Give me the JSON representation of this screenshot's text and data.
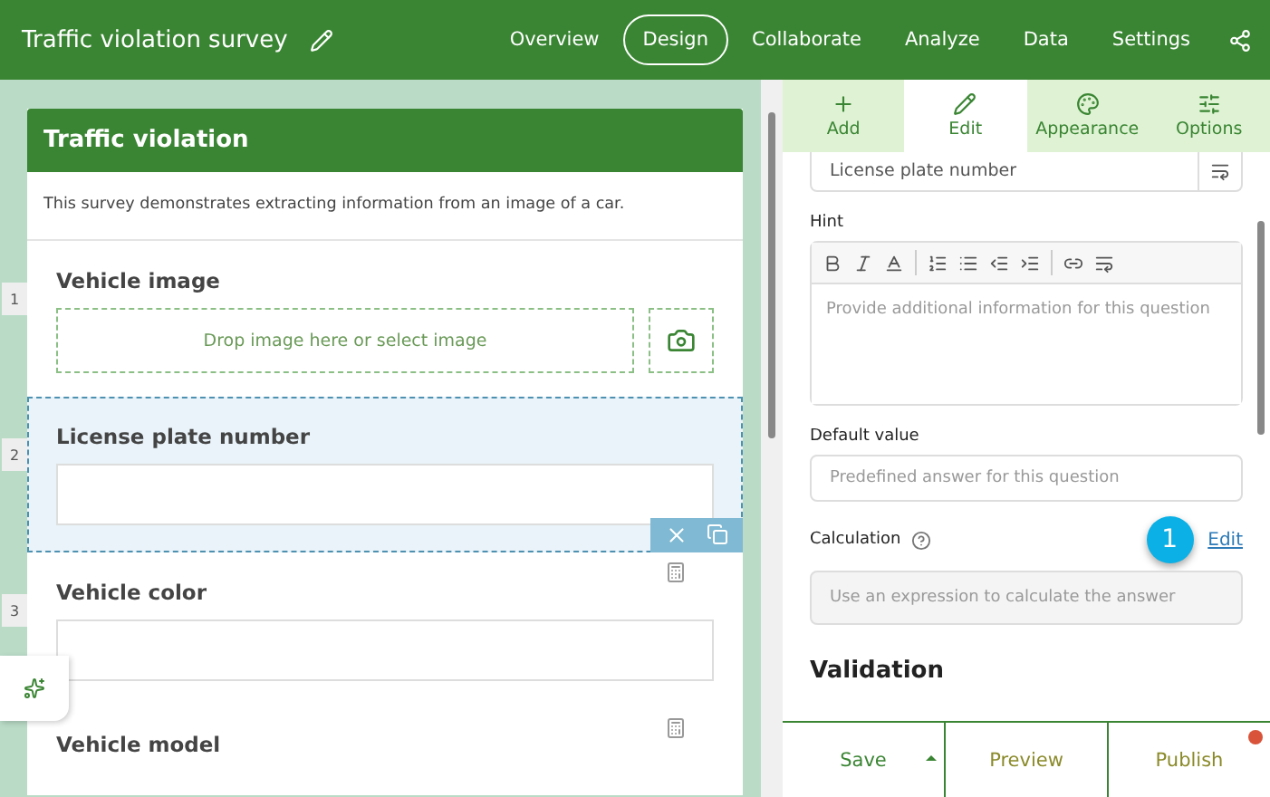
{
  "header": {
    "title": "Traffic violation survey",
    "nav": [
      {
        "label": "Overview",
        "selected": false
      },
      {
        "label": "Design",
        "selected": true
      },
      {
        "label": "Collaborate",
        "selected": false
      },
      {
        "label": "Analyze",
        "selected": false
      },
      {
        "label": "Data",
        "selected": false
      },
      {
        "label": "Settings",
        "selected": false
      }
    ]
  },
  "survey": {
    "title": "Traffic violation",
    "description": "This survey demonstrates extracting information from an image of a car.",
    "questions": [
      {
        "number": "1",
        "label": "Vehicle image",
        "kind": "image",
        "selected": false,
        "placeholder": "Drop image here or select image",
        "calculated": false
      },
      {
        "number": "2",
        "label": "License plate number",
        "kind": "text",
        "selected": true,
        "calculated": false
      },
      {
        "number": "3",
        "label": "Vehicle color",
        "kind": "text",
        "selected": false,
        "calculated": true
      },
      {
        "label": "Vehicle model",
        "kind": "label",
        "selected": false,
        "calculated": true
      }
    ]
  },
  "panel": {
    "tabs": [
      {
        "label": "Add",
        "selected": false
      },
      {
        "label": "Edit",
        "selected": true
      },
      {
        "label": "Appearance",
        "selected": false
      },
      {
        "label": "Options",
        "selected": false
      }
    ],
    "label_value": "License plate number",
    "hint": {
      "label": "Hint",
      "placeholder": "Provide additional information for this question"
    },
    "default_value": {
      "label": "Default value",
      "placeholder": "Predefined answer for this question"
    },
    "calculation": {
      "label": "Calculation",
      "link": "Edit",
      "badge": "1",
      "placeholder": "Use an expression to calculate the answer"
    },
    "section": "Validation",
    "actions": [
      {
        "label": "Save",
        "has_menu": true,
        "notification": false
      },
      {
        "label": "Preview",
        "has_menu": false,
        "notification": false
      },
      {
        "label": "Publish",
        "has_menu": false,
        "notification": true
      }
    ]
  }
}
